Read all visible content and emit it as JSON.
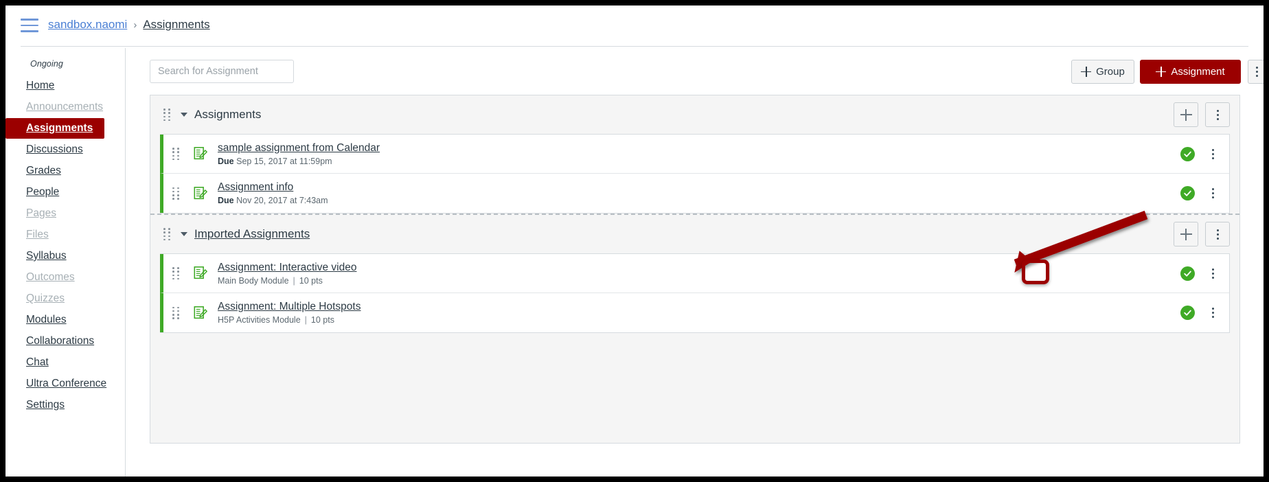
{
  "topbar": {
    "menu_icon": "hamburger-icon",
    "breadcrumb": {
      "course": "sandbox.naomi",
      "separator": "›",
      "current": "Assignments"
    }
  },
  "course_nav": {
    "term_label": "Ongoing",
    "items": [
      {
        "label": "Home",
        "state": "normal"
      },
      {
        "label": "Announcements",
        "state": "muted"
      },
      {
        "label": "Assignments",
        "state": "active"
      },
      {
        "label": "Discussions",
        "state": "normal"
      },
      {
        "label": "Grades",
        "state": "normal"
      },
      {
        "label": "People",
        "state": "normal"
      },
      {
        "label": "Pages",
        "state": "muted"
      },
      {
        "label": "Files",
        "state": "muted"
      },
      {
        "label": "Syllabus",
        "state": "normal"
      },
      {
        "label": "Outcomes",
        "state": "muted"
      },
      {
        "label": "Quizzes",
        "state": "muted"
      },
      {
        "label": "Modules",
        "state": "normal"
      },
      {
        "label": "Collaborations",
        "state": "normal"
      },
      {
        "label": "Chat",
        "state": "normal"
      },
      {
        "label": "Ultra Conference",
        "state": "normal"
      },
      {
        "label": "Settings",
        "state": "normal"
      }
    ]
  },
  "toolbar": {
    "search": {
      "value": "",
      "placeholder": "Search for Assignment"
    },
    "group_button": "Group",
    "assignment_button": "Assignment",
    "more_button_icon": "kebab-menu-icon"
  },
  "colors": {
    "brand_red": "#9b0000",
    "published_green": "#3faa26",
    "link_blue": "#4a7fd4",
    "text_dark": "#2d3b45",
    "panel_gray": "#f5f5f5",
    "annotation_red": "#9b0000"
  },
  "groups": [
    {
      "title": "Assignments",
      "linked": false,
      "add_button_icon": "plus-icon",
      "menu_button_icon": "kebab-menu-icon",
      "assignments": [
        {
          "title": "sample assignment from Calendar",
          "due_label": "Due",
          "due_value": "Sep 15, 2017 at 11:59pm",
          "module": "",
          "points": "",
          "published": true,
          "highlighted": false
        },
        {
          "title": "Assignment info",
          "due_label": "Due",
          "due_value": "Nov 20, 2017 at 7:43am",
          "module": "",
          "points": "",
          "published": true,
          "highlighted": false
        }
      ]
    },
    {
      "title": "Imported Assignments",
      "linked": true,
      "add_button_icon": "plus-icon",
      "menu_button_icon": "kebab-menu-icon",
      "assignments": [
        {
          "title": "Assignment: Interactive video",
          "due_label": "",
          "due_value": "",
          "module": "Main Body Module",
          "points": "10 pts",
          "published": true,
          "highlighted": true
        },
        {
          "title": "Assignment: Multiple Hotspots",
          "due_label": "",
          "due_value": "",
          "module": "H5P Activities Module",
          "points": "10 pts",
          "published": true,
          "highlighted": false
        }
      ]
    }
  ],
  "annotation": {
    "type": "arrow-and-highlight",
    "target": "kebab-menu-icon of Assignment: Interactive video row",
    "color": "#9b0000"
  }
}
